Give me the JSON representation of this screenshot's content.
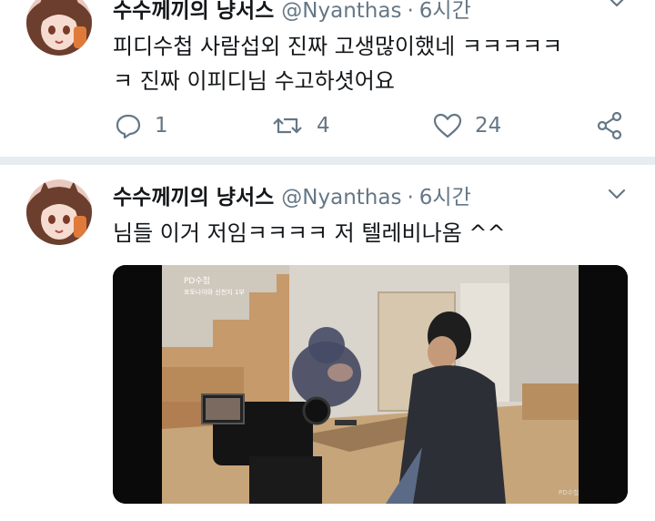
{
  "tweets": [
    {
      "author_name": "수수께끼의 냥서스",
      "handle": "@Nyanthas",
      "separator": "·",
      "time": "6시간",
      "text_lines": [
        "피디수첩 사람섭외 진짜 고생많이했네 ㅋㅋㅋㅋㅋ",
        "ㅋ 진짜 이피디님 수고하셧어요"
      ],
      "actions": {
        "replies": "1",
        "retweets": "4",
        "likes": "24"
      }
    },
    {
      "author_name": "수수께끼의 냥서스",
      "handle": "@Nyanthas",
      "separator": "·",
      "time": "6시간",
      "text_lines": [
        "님들 이거 저임ㅋㅋㅋㅋ 저 텔레비나옴 ^^"
      ],
      "media": {
        "type": "video-still",
        "overlay_logo": "PD수첩",
        "overlay_caption": "포토나야와 신천지 1부",
        "corner_watermark": "PD수첩"
      }
    }
  ],
  "icons": {
    "reply": "reply-icon",
    "retweet": "retweet-icon",
    "like": "heart-icon",
    "share": "share-icon",
    "menu": "chevron-down-icon"
  },
  "colors": {
    "text": "#14171a",
    "secondary": "#657786",
    "divider": "#e6ecf0",
    "background": "#ffffff"
  }
}
